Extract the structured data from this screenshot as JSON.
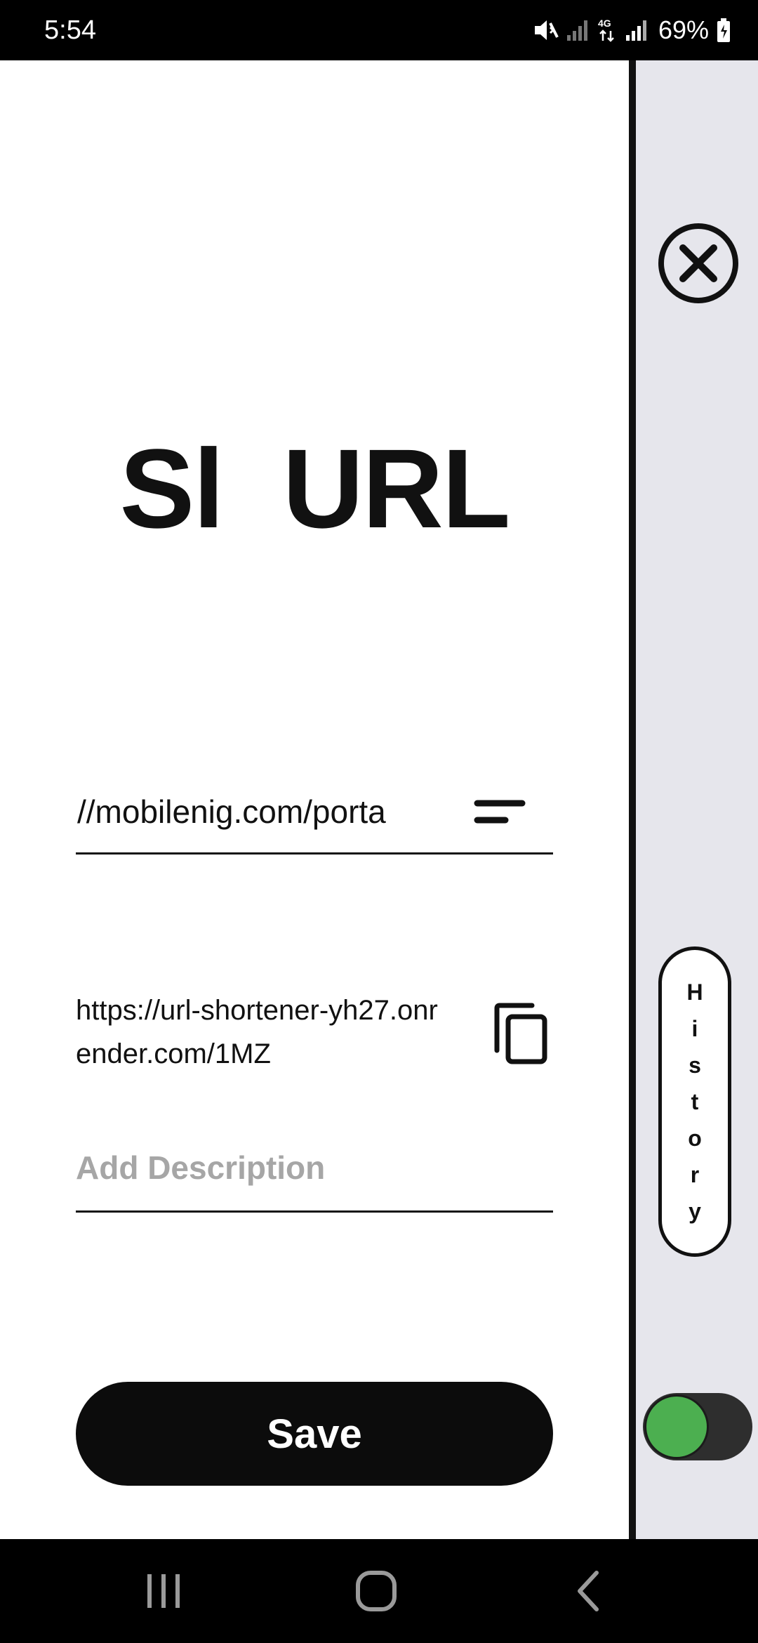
{
  "status_bar": {
    "time": "5:54",
    "battery": "69%",
    "network": "4G",
    "icons": [
      "mute-icon",
      "signal-icon",
      "network-4g-icon",
      "signal-icon",
      "battery-charging-icon"
    ]
  },
  "main": {
    "title": "Sl  URL",
    "url_input": {
      "value": "//mobilenig.com/porta"
    },
    "short_url": "https://url-shortener-yh27.onrender.com/1MZ",
    "description": {
      "placeholder": "Add Description",
      "value": ""
    },
    "save_label": "Save"
  },
  "side_panel": {
    "history_letters": [
      "H",
      "i",
      "s",
      "t",
      "o",
      "r",
      "y"
    ],
    "toggle_on": true,
    "toggle_color": "#4caf50"
  },
  "nav_bar": {
    "icons": [
      "recent-apps-icon",
      "home-icon",
      "back-icon"
    ]
  },
  "colors": {
    "primary": "#0c0c0c",
    "side_panel_bg": "#e6e6ec",
    "placeholder": "#a6a6a6",
    "accent": "#4caf50"
  }
}
